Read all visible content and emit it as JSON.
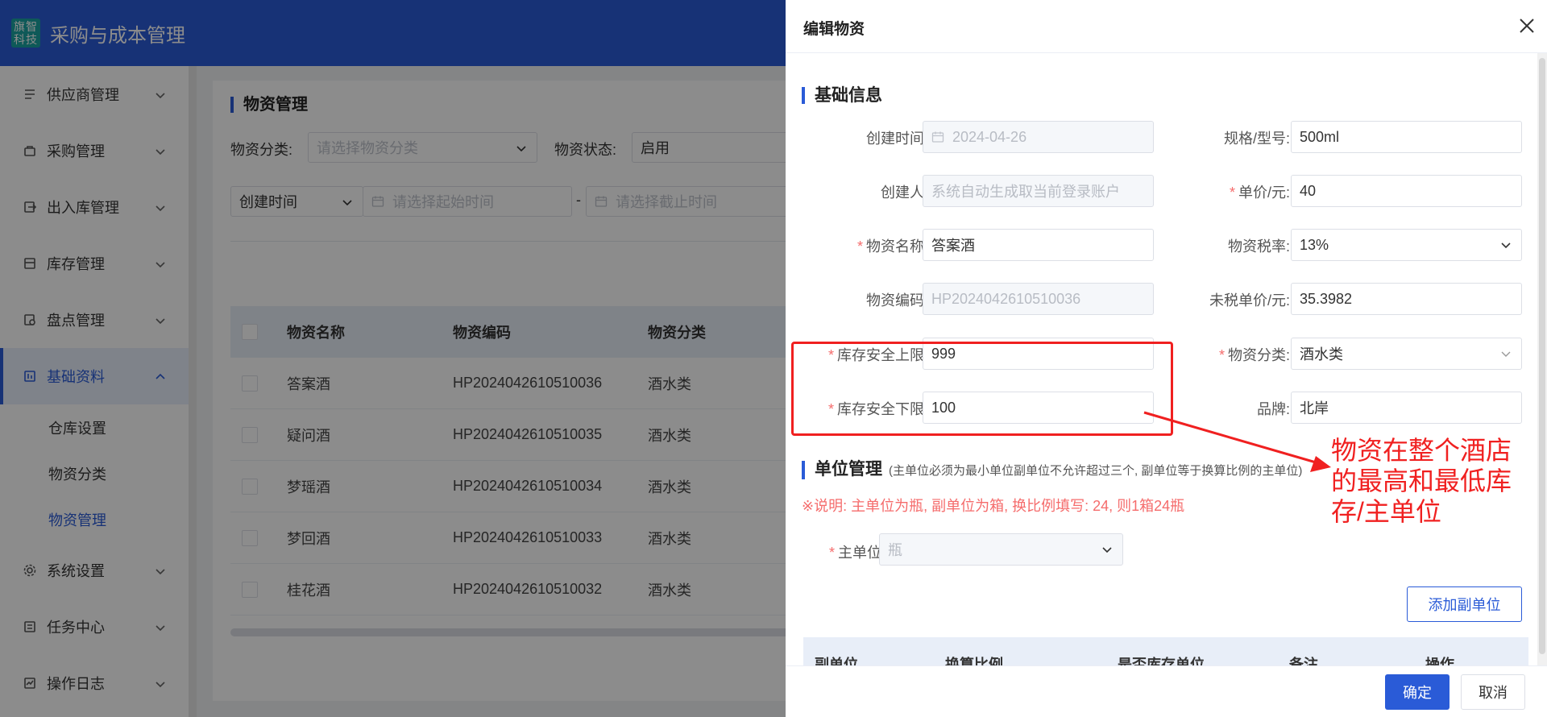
{
  "app": {
    "logo_line1": "旗智",
    "logo_line2": "科技",
    "title": "采购与成本管理"
  },
  "sidebar": {
    "items": [
      {
        "label": "供应商管理",
        "icon": "supplier-icon"
      },
      {
        "label": "采购管理",
        "icon": "cart-icon"
      },
      {
        "label": "出入库管理",
        "icon": "inout-icon"
      },
      {
        "label": "库存管理",
        "icon": "stock-icon"
      },
      {
        "label": "盘点管理",
        "icon": "inventory-check-icon"
      },
      {
        "label": "基础资料",
        "icon": "basic-data-icon",
        "active": true
      }
    ],
    "sub_items": [
      {
        "label": "仓库设置"
      },
      {
        "label": "物资分类"
      },
      {
        "label": "物资管理",
        "active": true
      }
    ],
    "items_after": [
      {
        "label": "系统设置",
        "icon": "gear-icon"
      },
      {
        "label": "任务中心",
        "icon": "task-icon"
      },
      {
        "label": "操作日志",
        "icon": "log-icon"
      }
    ]
  },
  "main": {
    "title": "物资管理",
    "filters": {
      "category_label": "物资分类:",
      "category_placeholder": "请选择物资分类",
      "status_label": "物资状态:",
      "status_value": "启用",
      "time_type": "创建时间",
      "start_placeholder": "请选择起始时间",
      "dash": "-",
      "end_placeholder": "请选择截止时间"
    },
    "table": {
      "headers": [
        "物资名称",
        "物资编码",
        "物资分类"
      ],
      "rows": [
        [
          "答案酒",
          "HP2024042610510036",
          "酒水类"
        ],
        [
          "疑问酒",
          "HP2024042610510035",
          "酒水类"
        ],
        [
          "梦瑶酒",
          "HP2024042610510034",
          "酒水类"
        ],
        [
          "梦回酒",
          "HP2024042610510033",
          "酒水类"
        ],
        [
          "桂花酒",
          "HP2024042610510032",
          "酒水类"
        ]
      ]
    }
  },
  "drawer": {
    "title": "编辑物资",
    "basic_section": "基础信息",
    "fields": {
      "create_time_label": "创建时间:",
      "create_time_value": "2024-04-26",
      "spec_label": "规格/型号:",
      "spec_value": "500ml",
      "creator_label": "创建人:",
      "creator_placeholder": "系统自动生成取当前登录账户",
      "price_label": "单价/元:",
      "price_value": "40",
      "name_label": "物资名称:",
      "name_value": "答案酒",
      "tax_label": "物资税率:",
      "tax_value": "13%",
      "code_label": "物资编码:",
      "code_value": "HP2024042610510036",
      "pretax_label": "未税单价/元:",
      "pretax_value": "35.3982",
      "upper_label": "库存安全上限:",
      "upper_value": "999",
      "category_label": "物资分类:",
      "category_value": "酒水类",
      "lower_label": "库存安全下限:",
      "lower_value": "100",
      "brand_label": "品牌:",
      "brand_value": "北岸"
    },
    "unit_section": "单位管理",
    "unit_note": "(主单位必须为最小单位副单位不允许超过三个, 副单位等于换算比例的主单位)",
    "unit_tip": "※说明: 主单位为瓶, 副单位为箱, 换比例填写: 24, 则1箱24瓶",
    "main_unit_label": "主单位:",
    "main_unit_value": "瓶",
    "add_sub_unit": "添加副单位",
    "sub_table_headers": [
      "副单位",
      "换算比例",
      "是否库存单位",
      "备注",
      "操作"
    ],
    "confirm": "确定",
    "cancel": "取消"
  },
  "annotation": {
    "text": "物资在整个酒店的最高和最低库存/主单位",
    "color": "#f02020"
  },
  "colors": {
    "primary": "#2a5bd7",
    "danger": "#f56c6c"
  }
}
